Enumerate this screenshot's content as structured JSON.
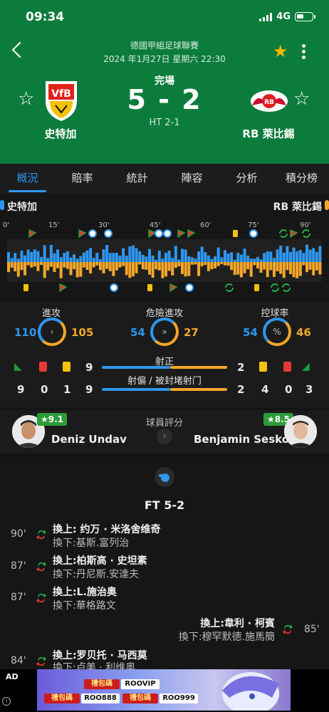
{
  "status_bar": {
    "time": "09:34",
    "network": "4G"
  },
  "header": {
    "league": "德國甲組足球聯賽",
    "datetime": "2024 年1月27日 星期六 22:30",
    "status": "完場",
    "score": "5 - 2",
    "halftime": "HT 2-1",
    "home": {
      "name": "史特加"
    },
    "away": {
      "name": "RB 萊比錫"
    }
  },
  "tabs": [
    "概況",
    "賠率",
    "統計",
    "陣容",
    "分析",
    "積分榜"
  ],
  "timeline": {
    "home_label": "史特加",
    "away_label": "RB 萊比錫",
    "ticks": [
      "0'",
      "15'",
      "30'",
      "45'",
      "60'",
      "75'",
      "90'"
    ],
    "colors": {
      "home": "#2e97f0",
      "away": "#f4a62a"
    }
  },
  "stats": {
    "attack": {
      "label": "進攻",
      "home": "110",
      "away": "105"
    },
    "dangerous": {
      "label": "危險進攻",
      "home": "54",
      "away": "27"
    },
    "possession": {
      "label": "控球率",
      "home": "54",
      "away": "46",
      "icon": "%"
    },
    "home_row1": [
      "9"
    ],
    "shots_on": {
      "label": "射正",
      "home": "9",
      "away": "2"
    },
    "shots_off": {
      "label": "射偏 / 被封堵射门",
      "home": "9",
      "away": "2"
    },
    "home_counts": [
      "9",
      "0",
      "1"
    ],
    "away_counts": [
      "4",
      "0",
      "3"
    ]
  },
  "player_rating": {
    "title": "球員評分",
    "home": {
      "name": "Deniz Undav",
      "rating": "★9.1"
    },
    "away": {
      "name": "Benjamin Sesko",
      "rating": "★8.5"
    }
  },
  "events": {
    "ft": "FT 5-2",
    "items": [
      {
        "minute": "90'",
        "in": "換上: 约万 · 米洛舍维奇",
        "out": "換下:基斯.富列治",
        "side": "home"
      },
      {
        "minute": "87'",
        "in": "換上:柏斯高 · 史坦素",
        "out": "換下:丹尼斯.安達夫",
        "side": "home"
      },
      {
        "minute": "87'",
        "in": "換上:L.施治奥",
        "out": "換下:華格路文",
        "side": "home"
      },
      {
        "minute": "85'",
        "in": "換上:韋利 · 柯賓",
        "out": "換下:穆罕默德.施馬簡",
        "side": "away"
      },
      {
        "minute": "84'",
        "in": "換上:罗贝托 · 马西莫",
        "out": "換下:卢美 · 利维奥",
        "side": "home"
      }
    ]
  },
  "ad": {
    "label": "AD",
    "codes": [
      "ROOVIP",
      "ROO888",
      "ROO999"
    ],
    "brand": "禮包碼"
  }
}
